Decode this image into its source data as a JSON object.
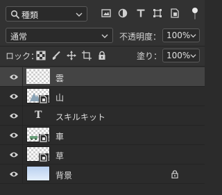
{
  "filter": {
    "kind_value": "種類",
    "icons": [
      "pixel-filter-icon",
      "adjustment-filter-icon",
      "type-filter-icon",
      "shape-filter-icon",
      "smart-object-filter-icon"
    ]
  },
  "blend": {
    "mode_value": "通常",
    "opacity_label": "不透明度：",
    "opacity_value": "100%"
  },
  "lock": {
    "label": "ロック：",
    "icons": [
      "lock-transparent-icon",
      "lock-image-icon",
      "lock-position-icon",
      "lock-artboard-icon",
      "lock-all-icon"
    ],
    "fill_label": "塗り：",
    "fill_value": "100%"
  },
  "layers": [
    {
      "name": "雲",
      "kind": "empty",
      "selected": true
    },
    {
      "name": "山",
      "kind": "smart",
      "selected": false
    },
    {
      "name": "スキルキット",
      "kind": "text",
      "selected": false
    },
    {
      "name": "車",
      "kind": "smart",
      "selected": false
    },
    {
      "name": "草",
      "kind": "smart",
      "selected": false
    },
    {
      "name": "背景",
      "kind": "background",
      "selected": false,
      "locked": true
    }
  ],
  "colors": {
    "panel_bg": "#323232",
    "list_bg": "#2b2b2b",
    "selected_row": "#444444",
    "text": "#d6d6d6"
  }
}
